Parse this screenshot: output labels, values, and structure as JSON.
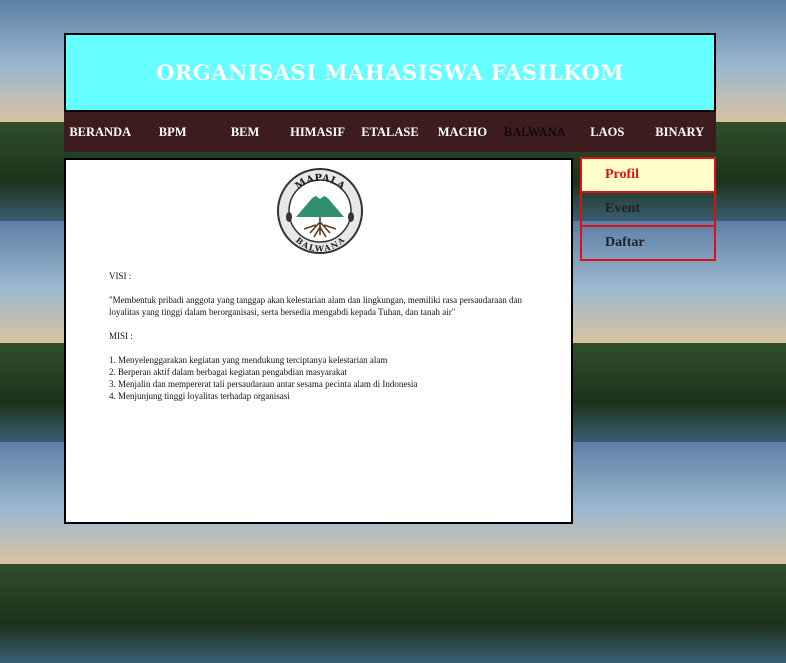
{
  "header": {
    "title": "ORGANISASI MAHASISWA FASILKOM"
  },
  "nav": {
    "items": [
      {
        "label": "BERANDA"
      },
      {
        "label": "BPM"
      },
      {
        "label": "BEM"
      },
      {
        "label": "HIMASIF"
      },
      {
        "label": "ETALASE"
      },
      {
        "label": "MACHO"
      },
      {
        "label": "BALWANA"
      },
      {
        "label": "LAOS"
      },
      {
        "label": "BINARY"
      }
    ]
  },
  "logo": {
    "top_text": "MAPALA",
    "bottom_text": "BALWANA"
  },
  "content": {
    "visi_heading": "VISI :",
    "visi_text": "\"Membentuk pribadi anggota yang tanggap akan kelestarian alam dan lingkungan, memiliki rasa persaudaraan dan loyalitas yang tinggi dalam berorganisasi, serta bersedia mengabdi kepada Tuhan, dan tanah air\"",
    "misi_heading": "MISI :",
    "misi_items": [
      "1. Menyelenggarakan kegiatan yang mendukung terciptanya kelestarian alam",
      "2. Berperan aktif dalam berbagai kegiatan pengabdian masyarakat",
      "3. Menjalin dan mempererat tali persaudaraan antar sesama pecinta alam di Indonesia",
      "4. Menjunjung tinggi loyalitas terhadap organisasi"
    ]
  },
  "sidebar": {
    "items": [
      {
        "label": "Profil"
      },
      {
        "label": "Event"
      },
      {
        "label": "Daftar"
      }
    ]
  },
  "colors": {
    "header_bg": "#66ffff",
    "nav_bg": "#3d1c20",
    "sidebar_border": "#e01010",
    "sidebar_active_bg": "#ffffcc"
  }
}
